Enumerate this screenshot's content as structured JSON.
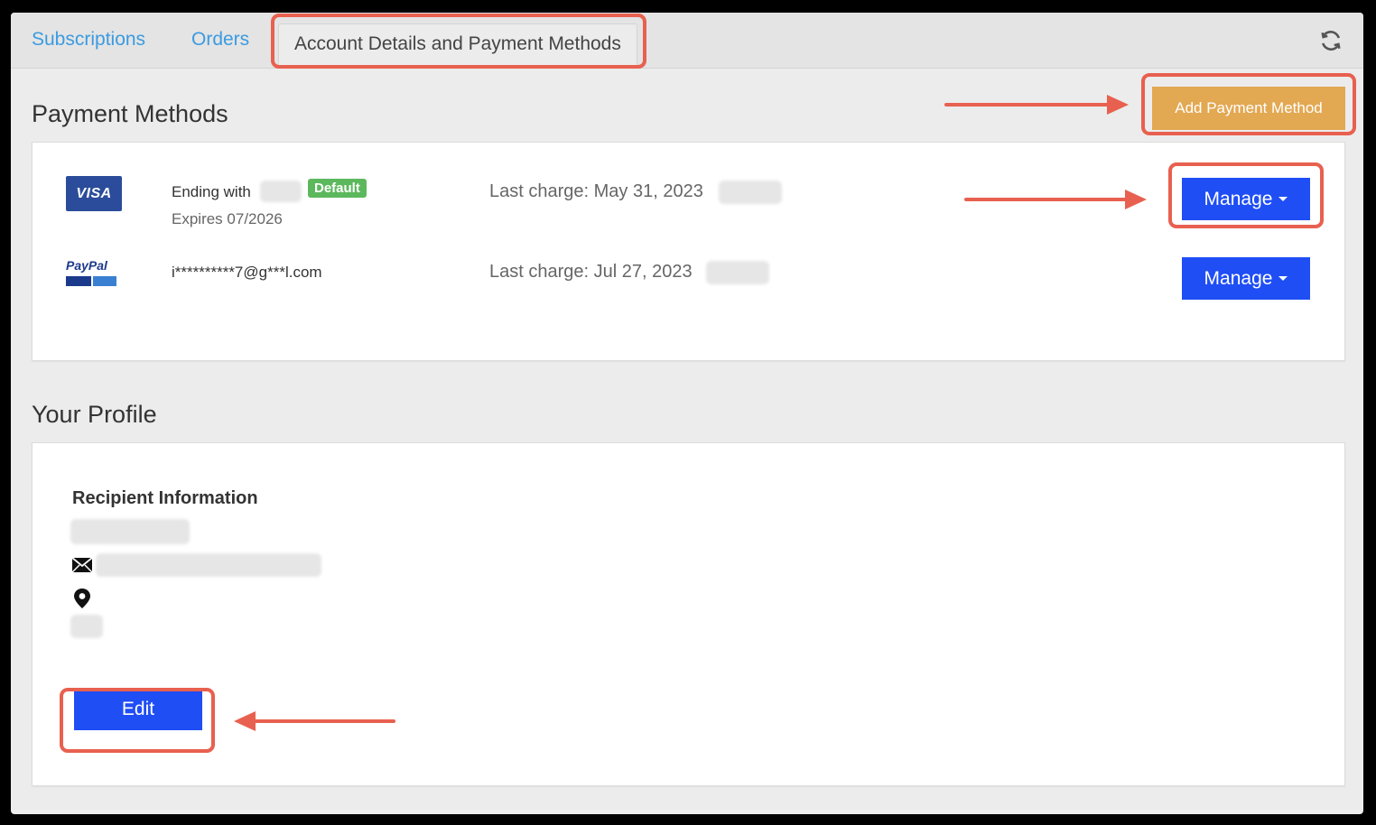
{
  "tabs": [
    {
      "label": "Subscriptions"
    },
    {
      "label": "Orders"
    },
    {
      "label": "Account Details and Payment Methods"
    }
  ],
  "payment_methods": {
    "title": "Payment Methods",
    "add_button": "Add Payment Method",
    "items": [
      {
        "brand": "VISA",
        "ending_label": "Ending with",
        "badge": "Default",
        "expires": "Expires 07/2026",
        "last_charge": "Last charge: May 31, 2023",
        "manage_label": "Manage"
      },
      {
        "brand": "PayPal",
        "account": "i**********7@g***l.com",
        "last_charge": "Last charge: Jul 27, 2023",
        "manage_label": "Manage"
      }
    ]
  },
  "profile": {
    "title": "Your Profile",
    "recipient_heading": "Recipient Information",
    "edit_label": "Edit"
  },
  "colors": {
    "accent_blue": "#1f4ef5",
    "add_button": "#e3a852",
    "default_badge": "#5cb85c",
    "annotation": "#e8604f",
    "tab_link": "#3b9be0"
  },
  "icons": [
    "refresh-icon",
    "envelope-icon",
    "location-pin-icon",
    "visa-logo",
    "paypal-logo"
  ]
}
